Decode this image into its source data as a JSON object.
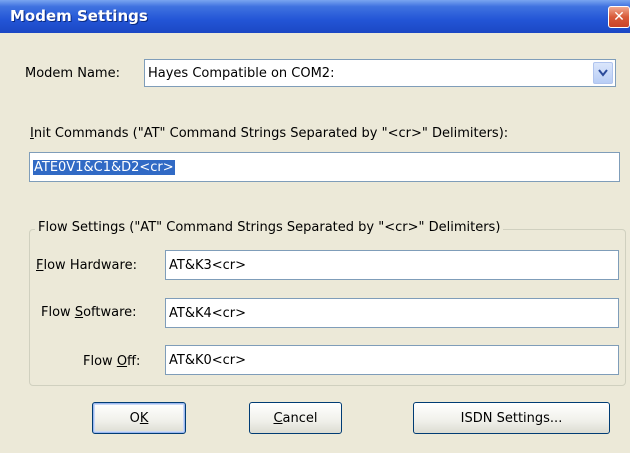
{
  "window": {
    "title": "Modem Settings",
    "close_glyph": "✕"
  },
  "modem_name": {
    "label": "Modem Name:",
    "value": "Hayes Compatible on COM2:"
  },
  "init": {
    "label_prefix": "",
    "label_underlined": "I",
    "label_rest": "nit Commands (\"AT\" Command Strings Separated by \"<cr>\" Delimiters):",
    "value": "ATE0V1&C1&D2<cr>"
  },
  "flow": {
    "legend": "Flow Settings (\"AT\" Command Strings Separated by \"<cr>\" Delimiters)",
    "hardware": {
      "label_underlined": "F",
      "label_rest": "low Hardware:",
      "value": "AT&K3<cr>"
    },
    "software": {
      "label_prefix": "Flow ",
      "label_underlined": "S",
      "label_rest": "oftware:",
      "value": "AT&K4<cr>"
    },
    "off": {
      "label_prefix": "Flow ",
      "label_underlined": "O",
      "label_rest": "ff:",
      "value": "AT&K0<cr>"
    }
  },
  "buttons": {
    "ok": {
      "prefix": "O",
      "underlined": "K",
      "rest": ""
    },
    "cancel": {
      "prefix": "",
      "underlined": "C",
      "rest": "ancel"
    },
    "isdn": {
      "label": "ISDN Settings..."
    }
  },
  "colors": {
    "titlebar": "#2355d6",
    "dialog_bg": "#ece9d8",
    "selection": "#316ac5",
    "close_button": "#d85a3a"
  }
}
